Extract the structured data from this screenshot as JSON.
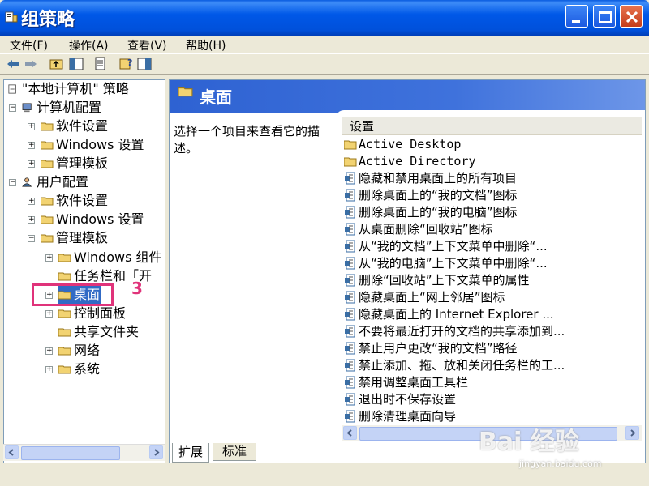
{
  "window": {
    "title": "组策略"
  },
  "menubar": [
    {
      "label": "文件(F)"
    },
    {
      "label": "操作(A)"
    },
    {
      "label": "查看(V)"
    },
    {
      "label": "帮助(H)"
    }
  ],
  "tree": {
    "nodes": [
      {
        "label": "\"本地计算机\" 策略"
      },
      {
        "label": "计算机配置"
      },
      {
        "label": "软件设置"
      },
      {
        "label": "Windows 设置"
      },
      {
        "label": "管理模板"
      },
      {
        "label": "用户配置"
      },
      {
        "label": "软件设置"
      },
      {
        "label": "Windows 设置"
      },
      {
        "label": "管理模板"
      },
      {
        "label": "Windows 组件"
      },
      {
        "label": "任务栏和「开"
      },
      {
        "label": "桌面"
      },
      {
        "label": "控制面板"
      },
      {
        "label": "共享文件夹"
      },
      {
        "label": "网络"
      },
      {
        "label": "系统"
      }
    ]
  },
  "right_pane": {
    "title": "桌面",
    "description": "选择一个项目来查看它的描述。",
    "column_header": "设置",
    "items": [
      {
        "label": "Active Desktop",
        "icon": "folder-icon"
      },
      {
        "label": "Active Directory",
        "icon": "folder-icon"
      },
      {
        "label": "隐藏和禁用桌面上的所有项目",
        "icon": "policy-icon"
      },
      {
        "label": "删除桌面上的“我的文档”图标",
        "icon": "policy-icon"
      },
      {
        "label": "删除桌面上的“我的电脑”图标",
        "icon": "policy-icon"
      },
      {
        "label": "从桌面删除“回收站”图标",
        "icon": "policy-icon"
      },
      {
        "label": "从“我的文档”上下文菜单中删除“...",
        "icon": "policy-icon"
      },
      {
        "label": "从“我的电脑”上下文菜单中删除“...",
        "icon": "policy-icon"
      },
      {
        "label": "删除“回收站”上下文菜单的属性",
        "icon": "policy-icon"
      },
      {
        "label": "隐藏桌面上“网上邻居”图标",
        "icon": "policy-icon"
      },
      {
        "label": "隐藏桌面上的 Internet Explorer ...",
        "icon": "policy-icon"
      },
      {
        "label": "不要将最近打开的文档的共享添加到...",
        "icon": "policy-icon"
      },
      {
        "label": "禁止用户更改“我的文档”路径",
        "icon": "policy-icon"
      },
      {
        "label": "禁止添加、拖、放和关闭任务栏的工...",
        "icon": "policy-icon"
      },
      {
        "label": "禁用调整桌面工具栏",
        "icon": "policy-icon"
      },
      {
        "label": "退出时不保存设置",
        "icon": "policy-icon"
      },
      {
        "label": "删除清理桌面向导",
        "icon": "policy-icon"
      }
    ]
  },
  "tabs": [
    {
      "label": "扩展"
    },
    {
      "label": "标准"
    }
  ],
  "annotation": {
    "step": "3"
  },
  "watermark": {
    "text": "Bai 经验",
    "sub": "jingyan.baidu.com"
  },
  "colors": {
    "title_bar": "#0054E3",
    "header_blue": "#2E62D2",
    "highlight": "#E0337A"
  }
}
